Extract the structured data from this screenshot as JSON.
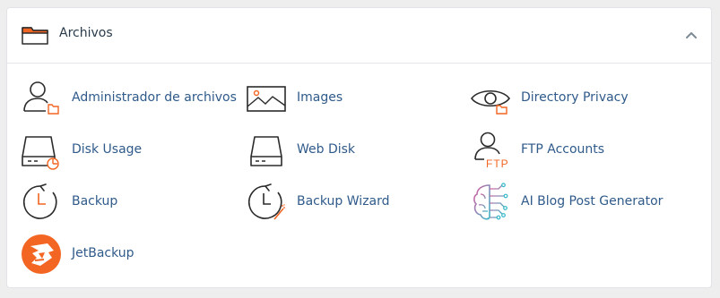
{
  "section": {
    "title": "Archivos",
    "items": [
      {
        "label": "Administrador de archivos",
        "icon": "file-manager-icon"
      },
      {
        "label": "Images",
        "icon": "images-icon"
      },
      {
        "label": "Directory Privacy",
        "icon": "directory-privacy-icon"
      },
      {
        "label": "Disk Usage",
        "icon": "disk-usage-icon"
      },
      {
        "label": "Web Disk",
        "icon": "web-disk-icon"
      },
      {
        "label": "FTP Accounts",
        "icon": "ftp-accounts-icon",
        "icon_text": "FTP"
      },
      {
        "label": "Backup",
        "icon": "backup-icon"
      },
      {
        "label": "Backup Wizard",
        "icon": "backup-wizard-icon"
      },
      {
        "label": "AI Blog Post Generator",
        "icon": "ai-brain-icon"
      },
      {
        "label": "JetBackup",
        "icon": "jetbackup-logo-icon"
      }
    ]
  },
  "colors": {
    "accent_orange": "#f26522",
    "icon_dark": "#2b2b2b",
    "link_blue": "#2f5a8a",
    "ai_gradient_pink": "#e05aa0",
    "ai_gradient_teal": "#35b8c8"
  }
}
